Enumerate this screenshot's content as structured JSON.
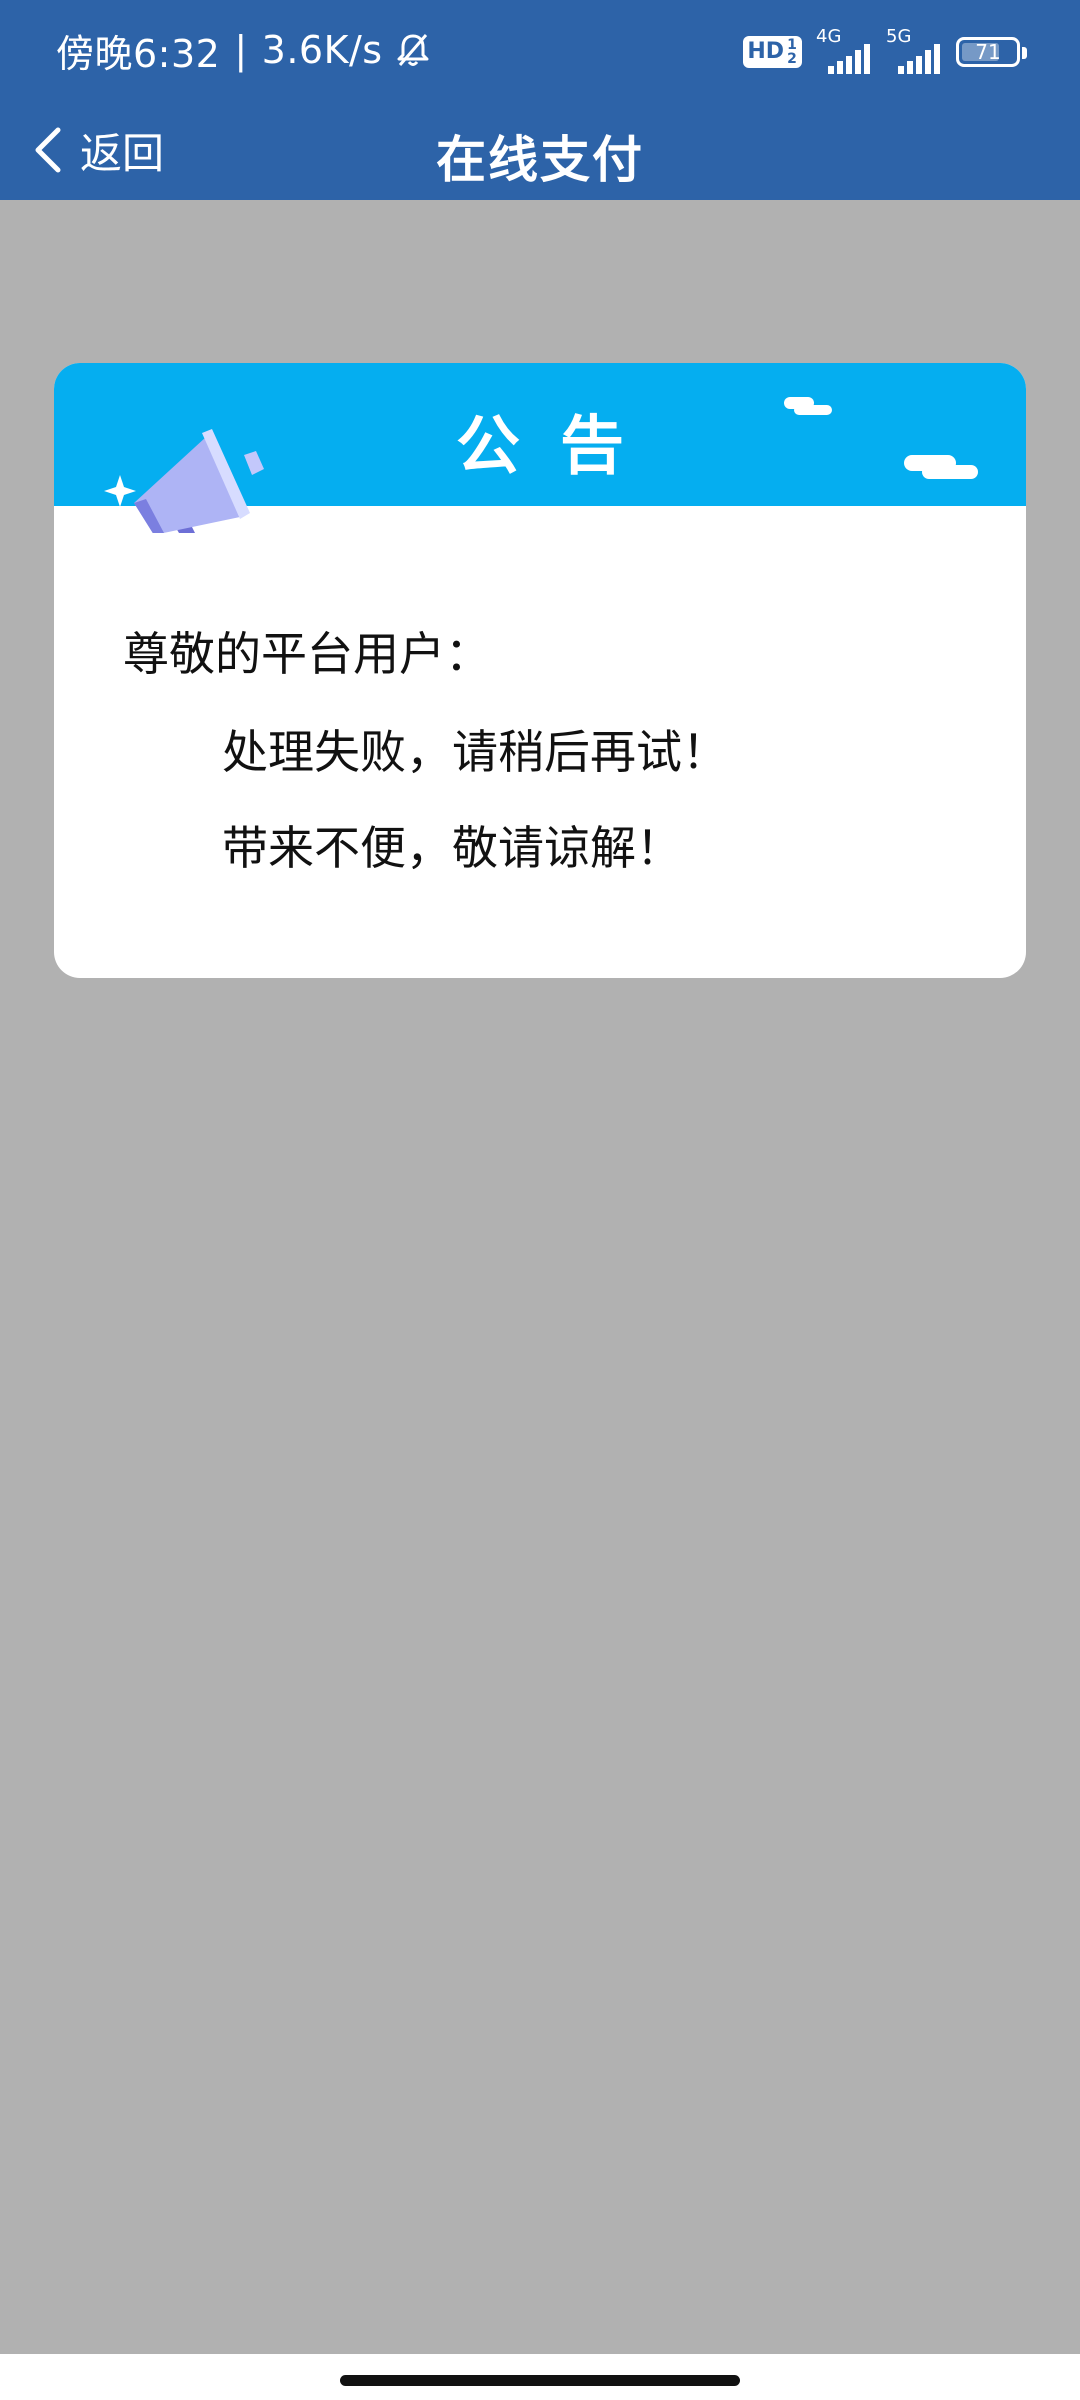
{
  "status_bar": {
    "time": "傍晚6:32",
    "separator": "|",
    "speed": "3.6K/s",
    "silent_icon": "bell-off-icon",
    "hd_label": "HD",
    "hd_sub": "1 2",
    "sim1_network": "4G",
    "sim2_network": "5G",
    "battery_percent": 71
  },
  "nav": {
    "back_label": "返回",
    "title": "在线支付"
  },
  "notice": {
    "title": "公告",
    "greeting": "尊敬的平台用户：",
    "message_1": "处理失败，请稍后再试！",
    "message_2": "带来不便，敬请谅解！"
  },
  "colors": {
    "header_bg": "#2d63a8",
    "page_bg": "#b1b1b1",
    "banner_bg": "#05aef0",
    "card_bg": "#ffffff"
  }
}
